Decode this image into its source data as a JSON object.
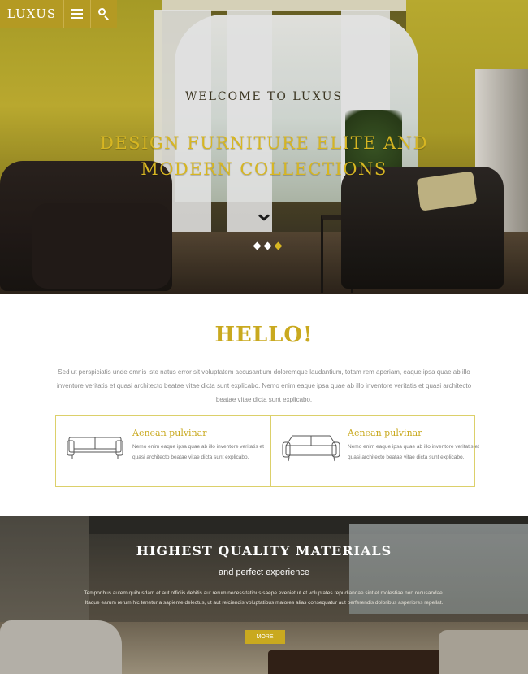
{
  "header": {
    "logo": "LUXUS",
    "menu_icon": "hamburger-menu-icon",
    "search_icon": "search-icon",
    "accent_color": "#b49a23"
  },
  "hero": {
    "welcome": "WELCOME TO LUXUS",
    "title": "DESIGN FURNITURE ELITE AND MODERN COLLECTIONS",
    "scroll_icon": "chevron-down-icon",
    "slider_dots": 3,
    "active_dot": 3
  },
  "hello": {
    "title": "HELLO!",
    "text": "Sed ut perspiciatis unde omnis iste natus error sit voluptatem accusantium doloremque laudantium, totam rem aperiam, eaque ipsa quae ab illo inventore veritatis et quasi architecto beatae vitae dicta sunt explicabo. Nemo enim eaque ipsa quae ab illo inventore veritatis et quasi architecto beatae vitae dicta sunt explicabo."
  },
  "features": [
    {
      "icon": "sofa-icon",
      "title": "Aenean pulvinar",
      "text": "Nemo enim eaque ipsa quae ab illo inventore veritatis et quasi architecto beatae vitae dicta sunt explicabo."
    },
    {
      "icon": "sofa-icon",
      "title": "Aenean pulvinar",
      "text": "Nemo enim eaque ipsa quae ab illo inventore veritatis et quasi architecto beatae vitae dicta sunt explicabo."
    }
  ],
  "quality": {
    "title": "HIGHEST QUALITY MATERIALS",
    "subtitle": "and perfect experience",
    "text": "Temporibus autem quibusdam et aut officiis debitis aut rerum necessitatibus saepe eveniet ut et voluptates repudiandae sint et molestiae non recusandae. Itaque earum rerum hic tenetur a sapiente delectus, ut aut reiciendis voluptatibus maiores alias consequatur aut perferendis doloribus asperiores repellat.",
    "button": "MORE"
  }
}
